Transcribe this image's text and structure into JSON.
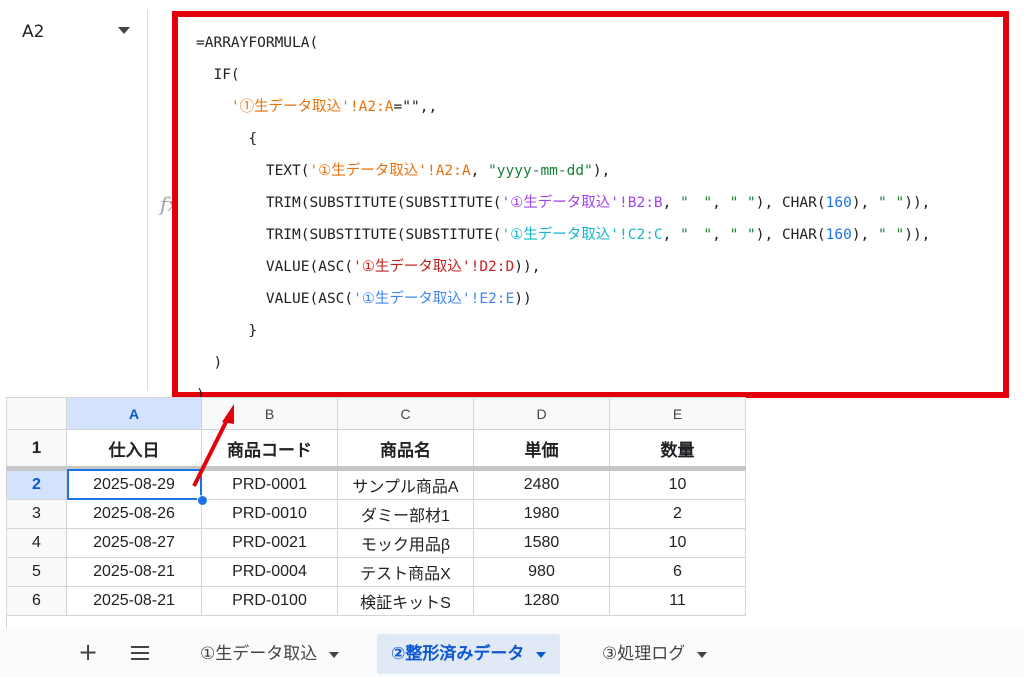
{
  "name_box": {
    "value": "A2"
  },
  "formula_bar": {
    "fx_label": "fx"
  },
  "formula_lines": [
    [
      {
        "t": "=ARRAYFORMULA(",
        "c": ""
      }
    ],
    [
      {
        "t": "  IF(",
        "c": ""
      }
    ],
    [
      {
        "t": "    '①生データ取込'!A2:A",
        "c": "c-or"
      },
      {
        "t": "=\"\",,",
        "c": ""
      }
    ],
    [
      {
        "t": "      {",
        "c": ""
      }
    ],
    [
      {
        "t": "        TEXT(",
        "c": ""
      },
      {
        "t": "'①生データ取込'!A2:A",
        "c": "c-or"
      },
      {
        "t": ", ",
        "c": ""
      },
      {
        "t": "\"yyyy-mm-dd\"",
        "c": "c-gr"
      },
      {
        "t": "),",
        "c": ""
      }
    ],
    [
      {
        "t": "        TRIM(SUBSTITUTE(SUBSTITUTE(",
        "c": ""
      },
      {
        "t": "'①生データ取込'!B2:B",
        "c": "c-pu"
      },
      {
        "t": ", ",
        "c": ""
      },
      {
        "t": "\"　\"",
        "c": "c-gr"
      },
      {
        "t": ", ",
        "c": ""
      },
      {
        "t": "\" \"",
        "c": "c-gr"
      },
      {
        "t": "), CHAR(",
        "c": ""
      },
      {
        "t": "160",
        "c": "c-num"
      },
      {
        "t": "), ",
        "c": ""
      },
      {
        "t": "\" \"",
        "c": "c-gr"
      },
      {
        "t": ")),",
        "c": ""
      }
    ],
    [
      {
        "t": "        TRIM(SUBSTITUTE(SUBSTITUTE(",
        "c": ""
      },
      {
        "t": "'①生データ取込'!C2:C",
        "c": "c-cy"
      },
      {
        "t": ", ",
        "c": ""
      },
      {
        "t": "\"　\"",
        "c": "c-gr"
      },
      {
        "t": ", ",
        "c": ""
      },
      {
        "t": "\" \"",
        "c": "c-gr"
      },
      {
        "t": "), CHAR(",
        "c": ""
      },
      {
        "t": "160",
        "c": "c-num"
      },
      {
        "t": "), ",
        "c": ""
      },
      {
        "t": "\" \"",
        "c": "c-gr"
      },
      {
        "t": ")),",
        "c": ""
      }
    ],
    [
      {
        "t": "        VALUE(ASC(",
        "c": ""
      },
      {
        "t": "'①生データ取込'!D2:D",
        "c": "c-pk"
      },
      {
        "t": ")),",
        "c": ""
      }
    ],
    [
      {
        "t": "        VALUE(ASC(",
        "c": ""
      },
      {
        "t": "'①生データ取込'!E2:E",
        "c": "c-bl"
      },
      {
        "t": "))",
        "c": ""
      }
    ],
    [
      {
        "t": "      }",
        "c": ""
      }
    ],
    [
      {
        "t": "  )",
        "c": ""
      }
    ],
    [
      {
        "t": ")",
        "c": ""
      }
    ]
  ],
  "grid": {
    "columns": [
      "A",
      "B",
      "C",
      "D",
      "E"
    ],
    "selected_column": "A",
    "header_row": {
      "row_number": "1",
      "cells": [
        "仕入日",
        "商品コード",
        "商品名",
        "単価",
        "数量"
      ]
    },
    "rows": [
      {
        "row_number": "2",
        "cells": [
          "2025-08-29",
          "PRD-0001",
          "サンプル商品A",
          "2480",
          "10"
        ]
      },
      {
        "row_number": "3",
        "cells": [
          "2025-08-26",
          "PRD-0010",
          "ダミー部材1",
          "1980",
          "2"
        ]
      },
      {
        "row_number": "4",
        "cells": [
          "2025-08-27",
          "PRD-0021",
          "モック用品β",
          "1580",
          "10"
        ]
      },
      {
        "row_number": "5",
        "cells": [
          "2025-08-21",
          "PRD-0004",
          "テスト商品X",
          "980",
          "6"
        ]
      },
      {
        "row_number": "6",
        "cells": [
          "2025-08-21",
          "PRD-0100",
          "検証キットS",
          "1280",
          "11"
        ]
      }
    ],
    "active_cell": "A2"
  },
  "sheet_tabs": {
    "add_icon": "+",
    "tabs": [
      {
        "label": "①生データ取込",
        "active": false
      },
      {
        "label": "②整形済みデータ",
        "active": true
      },
      {
        "label": "③処理ログ",
        "active": false
      }
    ]
  },
  "colors": {
    "highlight_border": "#e3000b",
    "accent": "#1a73e8",
    "active_tab_bg": "#e1e9f7"
  }
}
